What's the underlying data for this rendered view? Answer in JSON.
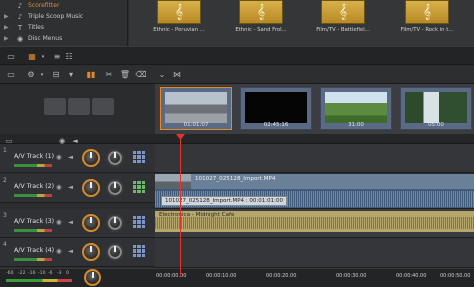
{
  "library_tree": {
    "items": [
      {
        "label": "Scorefitter",
        "icon": "music-note-icon",
        "selected": true
      },
      {
        "label": "Triple Scoop Music",
        "icon": "music-note-icon"
      },
      {
        "label": "Titles",
        "icon": "text-t-icon"
      },
      {
        "label": "Disc Menus",
        "icon": "disc-icon"
      }
    ]
  },
  "library_assets": [
    {
      "caption": "Ethnic - Peruvian ...",
      "icon": "music-clef-icon"
    },
    {
      "caption": "Ethnic - Sand Frol...",
      "icon": "music-clef-icon"
    },
    {
      "caption": "Film/TV - Battlefiel...",
      "icon": "music-clef-icon"
    },
    {
      "caption": "Film/TV - Rock in t...",
      "icon": "music-clef-icon"
    }
  ],
  "storyboard": {
    "scenes": [
      {
        "label": "01:01:07"
      },
      {
        "label": "02:45:16"
      },
      {
        "label": "31:00"
      },
      {
        "label": "05:00"
      }
    ]
  },
  "tracks": [
    {
      "num": "1",
      "name": "A/V Track (1)"
    },
    {
      "num": "2",
      "name": "A/V Track (2)"
    },
    {
      "num": "3",
      "name": "A/V Track (3)"
    },
    {
      "num": "4",
      "name": "A/V Track (4)"
    }
  ],
  "clips": {
    "video_title": "101027_025128_Import.MP4",
    "tooltip": "101027_025128_Import.MP4 : 00:01:01:00",
    "music_title": "Electronica - Midnight Cafe"
  },
  "ruler": {
    "labels": [
      "00:00:00.00",
      "00:00:10.00",
      "00:00:20.00",
      "00:00:30.00",
      "00:00:40.00",
      "00:00:50.00"
    ]
  },
  "meter_scale": [
    "-60",
    "-22",
    "-16",
    "-10",
    "-6",
    "-3",
    "0"
  ],
  "colors": {
    "accent": "#e28a2a",
    "playhead": "#e5322e",
    "video_clip": "#5b6f8a",
    "music_clip": "#b4a66c"
  }
}
